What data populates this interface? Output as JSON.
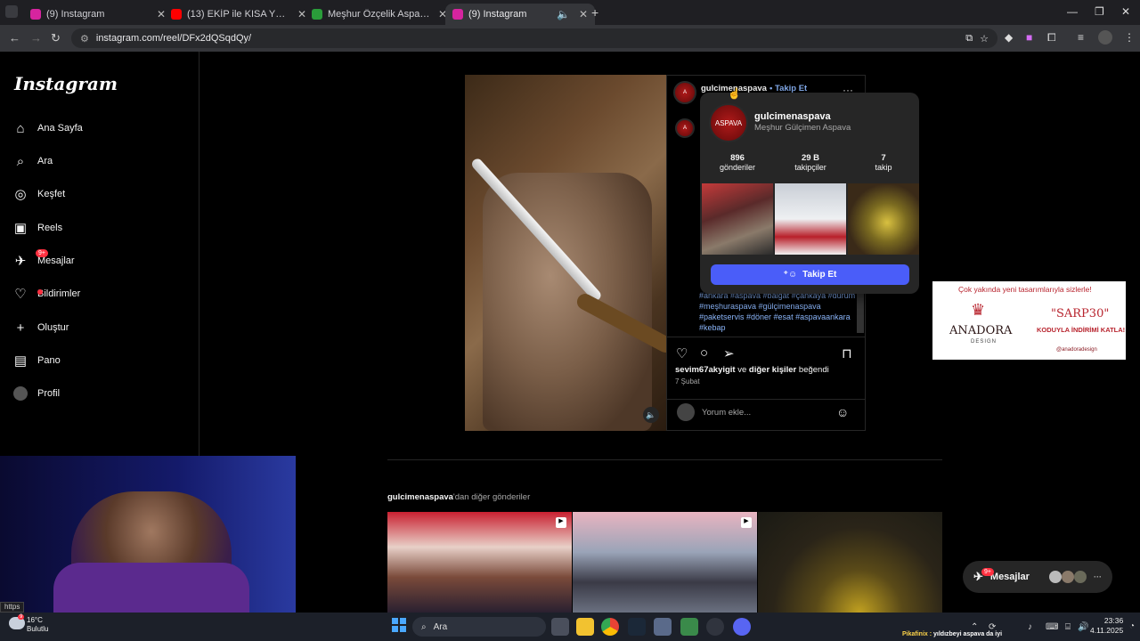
{
  "browser": {
    "tabs": [
      {
        "title": "(9) Instagram",
        "favicon_color": "#d6249f"
      },
      {
        "title": "(13) EKİP ile KISA YOL VLOG - Y",
        "favicon_color": "#ff0000"
      },
      {
        "title": "Meşhur Özçelik Aspava, Ankara",
        "favicon_color": "#2a9d3a"
      },
      {
        "title": "(9) Instagram",
        "favicon_color": "#d6249f"
      }
    ],
    "url": "instagram.com/reel/DFx2dQSqdQy/"
  },
  "instagram": {
    "logo": "Instagram",
    "nav": [
      {
        "label": "Ana Sayfa",
        "icon": "home-icon"
      },
      {
        "label": "Ara",
        "icon": "search-icon"
      },
      {
        "label": "Keşfet",
        "icon": "compass-icon"
      },
      {
        "label": "Reels",
        "icon": "reels-icon"
      },
      {
        "label": "Mesajlar",
        "icon": "messenger-icon",
        "badge": "9+"
      },
      {
        "label": "Bildirimler",
        "icon": "heart-icon"
      },
      {
        "label": "Oluştur",
        "icon": "plus-icon"
      },
      {
        "label": "Pano",
        "icon": "dashboard-icon"
      },
      {
        "label": "Profil",
        "icon": "avatar-icon"
      }
    ]
  },
  "post": {
    "username": "gulcimenaspava",
    "follow_label": "• Takip Et",
    "hashtags": "#ankara #aspava #balgat #çankaya #dürüm #meşhuraspava #gülçimenaspava #paketservis #döner #esat #aspavaankara #kebap",
    "likes_user": "sevim67akyigit",
    "likes_rest": " ve ",
    "likes_others": "diğer kişiler",
    "likes_suffix": " beğendi",
    "date": "7 Şubat",
    "comment_placeholder": "Yorum ekle..."
  },
  "hovercard": {
    "username": "gulcimenaspava",
    "fullname": "Meşhur Gülçimen Aspava",
    "stats": [
      {
        "value": "896",
        "label": "gönderiler"
      },
      {
        "value": "29 B",
        "label": "takipçiler"
      },
      {
        "value": "7",
        "label": "takip"
      }
    ],
    "follow_button": "Takip Et"
  },
  "ad": {
    "headline": "Çok yakında yeni tasarımlarıyla sizlerle!",
    "brand": "ANADORA",
    "brand_sub": "DESIGN",
    "code": "\"SARP30\"",
    "promo": "KODUYLA İNDİRİMİ KATLA!",
    "handle": "@anadoradesign"
  },
  "more": {
    "user": "gulcimenaspava",
    "suffix": "'dan diğer gönderiler"
  },
  "messages_pill": {
    "label": "Mesajlar",
    "badge": "9+"
  },
  "status_url": "https",
  "taskbar": {
    "temp": "16°C",
    "weather": "Bulutlu",
    "weather_badge": "9",
    "search": "Ara",
    "news_source": "Pikafinix : ",
    "news": "yıldızbeyi aspava da iyi",
    "time": "23:36",
    "date": "4.11.2025"
  },
  "colors": {
    "accent": "#4a5df9",
    "notify": "#ff3040",
    "link": "#8ab4f8"
  }
}
